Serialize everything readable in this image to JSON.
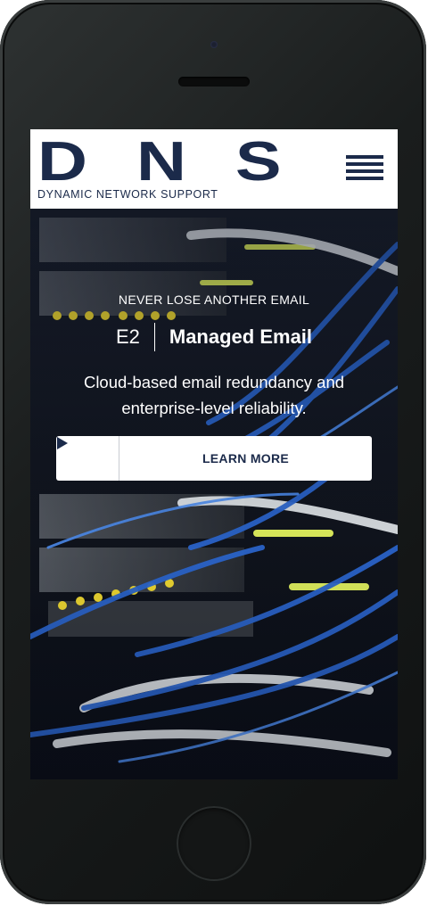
{
  "brand": {
    "letters": "DNS",
    "tagline": "DYNAMIC NETWORK SUPPORT",
    "color": "#1b2a4a"
  },
  "header": {
    "menu_icon": "hamburger-menu-icon"
  },
  "hero": {
    "eyebrow": "NEVER LOSE ANOTHER EMAIL",
    "product_code": "E2",
    "product_name": "Managed Email",
    "description": "Cloud-based email redundancy and enterprise-level reliability.",
    "cta": {
      "icon": "play-icon",
      "label": "LEARN MORE"
    },
    "background_image": "server-rack-fiber-cables"
  }
}
